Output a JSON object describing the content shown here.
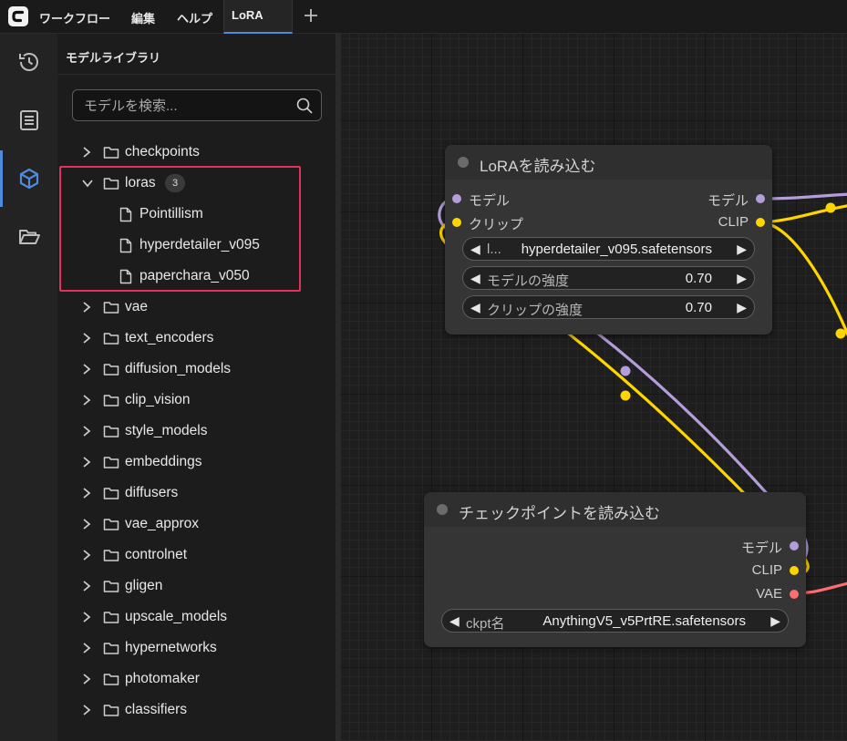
{
  "menu": {
    "workflow": "ワークフロー",
    "edit": "編集",
    "help": "ヘルプ"
  },
  "tabs": [
    {
      "label": "LoRA"
    }
  ],
  "rail": {
    "items": [
      {
        "icon": "history-icon"
      },
      {
        "icon": "book-icon"
      },
      {
        "icon": "cube-icon"
      },
      {
        "icon": "folder-open-icon"
      }
    ]
  },
  "sidebar": {
    "title": "モデルライブラリ",
    "search_placeholder": "モデルを検索...",
    "folders": [
      {
        "label": "checkpoints"
      },
      {
        "label": "loras",
        "count": "3",
        "expanded": true,
        "files": [
          "Pointillism",
          "hyperdetailer_v095",
          "paperchara_v050"
        ]
      },
      {
        "label": "vae"
      },
      {
        "label": "text_encoders"
      },
      {
        "label": "diffusion_models"
      },
      {
        "label": "clip_vision"
      },
      {
        "label": "style_models"
      },
      {
        "label": "embeddings"
      },
      {
        "label": "diffusers"
      },
      {
        "label": "vae_approx"
      },
      {
        "label": "controlnet"
      },
      {
        "label": "gligen"
      },
      {
        "label": "upscale_models"
      },
      {
        "label": "hypernetworks"
      },
      {
        "label": "photomaker"
      },
      {
        "label": "classifiers"
      }
    ]
  },
  "nodes": {
    "lora": {
      "title": "LoRAを読み込む",
      "input_model": "モデル",
      "input_clip": "クリップ",
      "output_model": "モデル",
      "output_clip": "CLIP",
      "w_name_label": "l...",
      "w_name_value": "hyperdetailer_v095.safetensors",
      "w_model_label": "モデルの強度",
      "w_model_value": "0.70",
      "w_clip_label": "クリップの強度",
      "w_clip_value": "0.70"
    },
    "checkpoint": {
      "title": "チェックポイントを読み込む",
      "output_model": "モデル",
      "output_clip": "CLIP",
      "output_vae": "VAE",
      "w_ckpt_label": "ckpt名",
      "w_ckpt_value": "AnythingV5_v5PrtRE.safetensors"
    }
  },
  "colors": {
    "accent": "#4f8bdc",
    "highlight": "#e5305d",
    "model_wire": "#b39ddb",
    "clip_wire": "#ffd500",
    "vae_wire": "#ff6e6e"
  }
}
